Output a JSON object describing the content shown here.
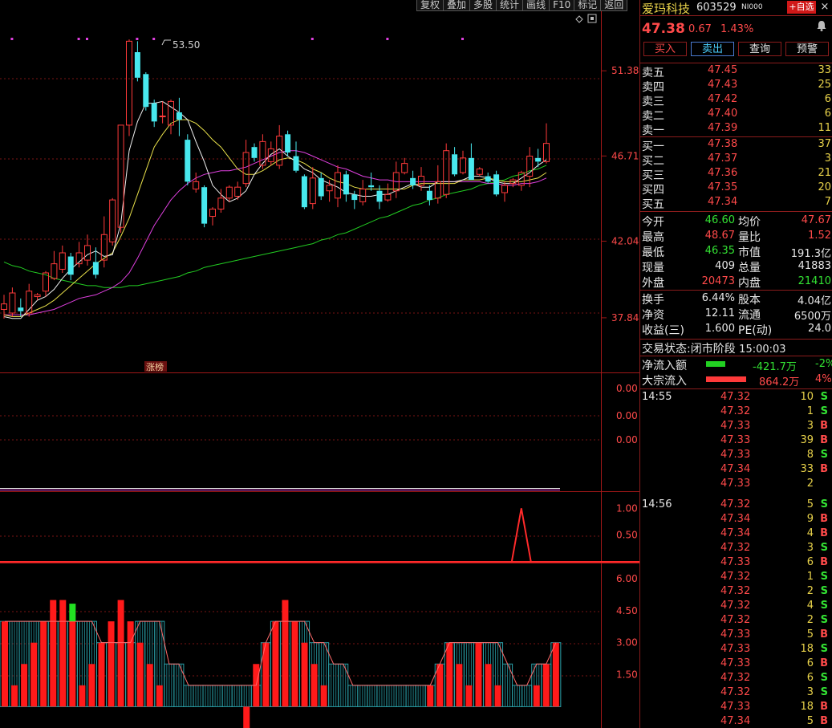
{
  "toolbar": [
    "复权",
    "叠加",
    "多股",
    "统计",
    "画线",
    "F10",
    "标记",
    "返回"
  ],
  "stock": {
    "name": "爱玛科技",
    "code": "603529",
    "tag": "NI000",
    "price": "47.38",
    "change": "0.67",
    "change_pct": "1.43%",
    "fav_label": "+自选",
    "close_label": "×"
  },
  "trade_buttons": [
    "买入",
    "卖出",
    "查询",
    "预警"
  ],
  "order_book": {
    "asks": [
      {
        "label": "卖五",
        "price": "47.45",
        "volume": "33"
      },
      {
        "label": "卖四",
        "price": "47.43",
        "volume": "25"
      },
      {
        "label": "卖三",
        "price": "47.42",
        "volume": "6"
      },
      {
        "label": "卖二",
        "price": "47.40",
        "volume": "6"
      },
      {
        "label": "卖一",
        "price": "47.39",
        "volume": "11"
      }
    ],
    "bids": [
      {
        "label": "买一",
        "price": "47.38",
        "volume": "37"
      },
      {
        "label": "买二",
        "price": "47.37",
        "volume": "3"
      },
      {
        "label": "买三",
        "price": "47.36",
        "volume": "21"
      },
      {
        "label": "买四",
        "price": "47.35",
        "volume": "20"
      },
      {
        "label": "买五",
        "price": "47.34",
        "volume": "7"
      }
    ]
  },
  "stats": {
    "open_label": "今开",
    "open": "46.60",
    "avg_label": "均价",
    "avg": "47.67",
    "high_label": "最高",
    "high": "48.67",
    "vol_ratio_label": "量比",
    "vol_ratio": "1.52",
    "low_label": "最低",
    "low": "46.35",
    "mktcap_label": "市值",
    "mktcap": "191.3亿",
    "cur_vol_label": "现量",
    "cur_vol": "409",
    "total_vol_label": "总量",
    "total_vol": "41883",
    "outer_label": "外盘",
    "outer": "20473",
    "inner_label": "内盘",
    "inner": "21410",
    "turnover_label": "换手",
    "turnover": "6.44%",
    "shares_label": "股本",
    "shares": "4.04亿",
    "nav_label": "净资",
    "nav": "12.11",
    "float_label": "流通",
    "float": "6500万",
    "eps_label": "收益(三)",
    "eps": "1.600",
    "pe_label": "PE(动)",
    "pe": "24.0"
  },
  "status": {
    "label": "交易状态:",
    "value": "闭市阶段",
    "time": "15:00:03"
  },
  "flows": {
    "net_label": "净流入额",
    "net_value": "-421.7万",
    "net_pct": "-2%",
    "block_label": "大宗流入",
    "block_value": "864.2万",
    "block_pct": "4%"
  },
  "ticks": [
    {
      "time": "14:55",
      "price": "47.32",
      "vol": "10",
      "side": "S"
    },
    {
      "time": "",
      "price": "47.32",
      "vol": "1",
      "side": "S"
    },
    {
      "time": "",
      "price": "47.33",
      "vol": "3",
      "side": "B"
    },
    {
      "time": "",
      "price": "47.33",
      "vol": "39",
      "side": "B"
    },
    {
      "time": "",
      "price": "47.33",
      "vol": "8",
      "side": "S"
    },
    {
      "time": "",
      "price": "47.34",
      "vol": "33",
      "side": "B"
    },
    {
      "time": "",
      "price": "47.33",
      "vol": "2",
      "side": ""
    },
    {
      "time": "14:56",
      "price": "47.32",
      "vol": "5",
      "side": "S"
    },
    {
      "time": "",
      "price": "47.34",
      "vol": "9",
      "side": "B"
    },
    {
      "time": "",
      "price": "47.34",
      "vol": "4",
      "side": "B"
    },
    {
      "time": "",
      "price": "47.32",
      "vol": "3",
      "side": "S"
    },
    {
      "time": "",
      "price": "47.33",
      "vol": "6",
      "side": "B"
    },
    {
      "time": "",
      "price": "47.32",
      "vol": "1",
      "side": "S"
    },
    {
      "time": "",
      "price": "47.32",
      "vol": "2",
      "side": "S"
    },
    {
      "time": "",
      "price": "47.32",
      "vol": "4",
      "side": "S"
    },
    {
      "time": "",
      "price": "47.32",
      "vol": "2",
      "side": "S"
    },
    {
      "time": "",
      "price": "47.33",
      "vol": "5",
      "side": "B"
    },
    {
      "time": "",
      "price": "47.33",
      "vol": "18",
      "side": "S"
    },
    {
      "time": "",
      "price": "47.33",
      "vol": "6",
      "side": "B"
    },
    {
      "time": "",
      "price": "47.32",
      "vol": "6",
      "side": "S"
    },
    {
      "time": "",
      "price": "47.32",
      "vol": "3",
      "side": "S"
    },
    {
      "time": "",
      "price": "47.33",
      "vol": "18",
      "side": "B"
    },
    {
      "time": "",
      "price": "47.34",
      "vol": "5",
      "side": "B"
    }
  ],
  "chart_data": {
    "type": "candlestick",
    "price_axis": {
      "ticks": [
        "51.38",
        "46.71",
        "42.04",
        "37.84"
      ],
      "ylim": [
        35.9,
        54.6
      ]
    },
    "high_label": "53.50",
    "limit_up_label": "涨榜",
    "colors": {
      "up": "#ff3a3a",
      "down": "#48e8ee",
      "ma1": "#f0f0f0",
      "ma2": "#e8e04a",
      "ma3": "#e040e0",
      "ma4": "#22cc22"
    },
    "candles": [
      [
        38.3,
        38.6,
        37.8,
        39.1
      ],
      [
        38.1,
        39.2,
        37.9,
        39.5
      ],
      [
        38.4,
        38.2,
        37.9,
        38.9
      ],
      [
        38.1,
        39.3,
        37.9,
        39.7
      ],
      [
        39.0,
        39.1,
        38.8,
        39.2
      ],
      [
        39.3,
        40.3,
        39.0,
        40.4
      ],
      [
        40.0,
        40.8,
        39.9,
        41.5
      ],
      [
        40.5,
        41.4,
        40.3,
        41.8
      ],
      [
        41.2,
        40.2,
        39.9,
        41.4
      ],
      [
        40.8,
        41.4,
        40.6,
        42.0
      ],
      [
        41.0,
        41.8,
        40.7,
        42.4
      ],
      [
        40.9,
        40.2,
        40.0,
        41.7
      ],
      [
        41.0,
        42.4,
        40.6,
        43.4
      ],
      [
        42.0,
        44.3,
        41.8,
        44.4
      ],
      [
        42.8,
        48.4,
        42.5,
        48.4
      ],
      [
        48.4,
        53.0,
        47.8,
        53.1
      ],
      [
        52.4,
        51.0,
        50.8,
        53.0
      ],
      [
        51.2,
        49.4,
        49.2,
        51.3
      ],
      [
        49.6,
        48.6,
        48.3,
        49.8
      ],
      [
        48.9,
        48.9,
        48.5,
        49.7
      ],
      [
        48.4,
        49.7,
        47.9,
        49.8
      ],
      [
        49.1,
        48.7,
        47.8,
        49.9
      ],
      [
        47.6,
        45.3,
        45.1,
        47.9
      ],
      [
        44.9,
        45.3,
        44.7,
        45.8
      ],
      [
        45.0,
        43.0,
        42.8,
        45.1
      ],
      [
        43.4,
        43.8,
        42.9,
        43.9
      ],
      [
        43.8,
        44.4,
        43.6,
        44.9
      ],
      [
        44.4,
        45.0,
        44.2,
        45.1
      ],
      [
        44.5,
        45.0,
        44.3,
        45.3
      ],
      [
        45.2,
        46.9,
        45.0,
        47.6
      ],
      [
        47.2,
        46.6,
        46.4,
        47.4
      ],
      [
        46.2,
        47.5,
        46.0,
        47.9
      ],
      [
        46.4,
        47.1,
        46.2,
        47.5
      ],
      [
        46.2,
        47.8,
        46.0,
        48.4
      ],
      [
        47.9,
        46.9,
        46.7,
        48.1
      ],
      [
        46.7,
        45.9,
        45.8,
        47.5
      ],
      [
        45.6,
        43.9,
        43.8,
        45.7
      ],
      [
        44.1,
        45.5,
        43.8,
        46.1
      ],
      [
        45.5,
        44.5,
        44.3,
        45.8
      ],
      [
        44.8,
        45.1,
        44.2,
        45.4
      ],
      [
        44.4,
        45.8,
        43.9,
        46.2
      ],
      [
        45.7,
        44.6,
        44.2,
        45.9
      ],
      [
        44.6,
        44.3,
        43.8,
        44.8
      ],
      [
        44.2,
        44.9,
        44.0,
        45.4
      ],
      [
        45.1,
        45.0,
        44.8,
        45.8
      ],
      [
        44.8,
        44.2,
        43.8,
        45.1
      ],
      [
        44.3,
        44.6,
        44.2,
        45.2
      ],
      [
        44.8,
        45.8,
        44.4,
        46.4
      ],
      [
        45.8,
        46.3,
        45.7,
        46.6
      ],
      [
        45.5,
        45.1,
        44.9,
        45.9
      ],
      [
        45.1,
        45.6,
        44.8,
        46.1
      ],
      [
        44.8,
        44.3,
        44.0,
        45.1
      ],
      [
        44.4,
        45.3,
        44.1,
        46.2
      ],
      [
        44.6,
        47.0,
        44.4,
        47.4
      ],
      [
        46.8,
        45.7,
        45.6,
        47.2
      ],
      [
        45.8,
        46.6,
        45.7,
        47.0
      ],
      [
        46.6,
        45.4,
        45.4,
        47.4
      ],
      [
        45.7,
        46.0,
        45.6,
        46.1
      ],
      [
        45.6,
        45.3,
        45.2,
        45.8
      ],
      [
        45.7,
        44.6,
        44.5,
        45.9
      ],
      [
        44.7,
        45.1,
        44.2,
        45.3
      ],
      [
        45.2,
        45.4,
        45.0,
        45.5
      ],
      [
        45.1,
        45.8,
        44.8,
        45.9
      ],
      [
        45.6,
        46.7,
        45.0,
        47.2
      ],
      [
        46.6,
        46.4,
        46.1,
        47.1
      ],
      [
        46.4,
        47.4,
        46.3,
        48.5
      ]
    ],
    "ma1": [
      37.9,
      37.8,
      37.8,
      38.3,
      38.8,
      39.0,
      39.4,
      40.0,
      40.5,
      40.9,
      41.3,
      41.5,
      41.2,
      41.3,
      43.0,
      47.0,
      48.6,
      49.6,
      49.6,
      49.7,
      49.4,
      49.1,
      48.7,
      47.5,
      46.4,
      45.1,
      44.6,
      44.2,
      44.4,
      44.8,
      45.7,
      46.3,
      46.8,
      47.1,
      46.7,
      46.4,
      46.0,
      45.8,
      45.4,
      45.2,
      45.0,
      44.7,
      44.6,
      44.5,
      44.5,
      44.6,
      44.6,
      44.8,
      45.0,
      45.2,
      45.0,
      45.0,
      45.3,
      45.3,
      45.3,
      45.4,
      45.6,
      45.6,
      45.5,
      45.3,
      45.2,
      45.2,
      45.5,
      45.8,
      46.2,
      46.5
    ],
    "ma2": [
      38.0,
      37.9,
      37.9,
      38.1,
      38.3,
      38.5,
      38.8,
      39.2,
      39.6,
      40.0,
      40.4,
      40.8,
      41.1,
      41.4,
      42.3,
      43.3,
      44.6,
      45.9,
      47.2,
      47.9,
      48.5,
      48.7,
      48.7,
      48.5,
      48.1,
      47.6,
      47.2,
      46.6,
      46.0,
      45.7,
      45.7,
      45.9,
      46.2,
      46.5,
      46.6,
      46.5,
      46.3,
      46.0,
      45.8,
      45.5,
      45.3,
      45.2,
      45.0,
      44.9,
      44.9,
      44.9,
      44.9,
      44.9,
      44.9,
      45.1,
      45.2,
      45.2,
      45.2,
      45.2,
      45.2,
      45.4,
      45.4,
      45.4,
      45.5,
      45.4,
      45.3,
      45.3,
      45.3,
      45.4,
      45.5,
      45.8
    ],
    "ma3": [
      38.0,
      38.0,
      38.0,
      38.0,
      38.1,
      38.2,
      38.3,
      38.5,
      38.7,
      38.9,
      39.0,
      39.1,
      39.3,
      39.5,
      39.8,
      40.3,
      41.1,
      42.0,
      42.9,
      43.6,
      44.3,
      44.8,
      45.2,
      45.5,
      45.7,
      45.8,
      45.9,
      45.9,
      46.0,
      46.1,
      46.3,
      46.5,
      46.7,
      46.9,
      47.0,
      47.0,
      46.9,
      46.7,
      46.5,
      46.3,
      46.1,
      46.0,
      45.8,
      45.6,
      45.5,
      45.4,
      45.4,
      45.3,
      45.3,
      45.3,
      45.3,
      45.3,
      45.3,
      45.3,
      45.3,
      45.3,
      45.3,
      45.3,
      45.2,
      45.2,
      45.1,
      45.1,
      45.2,
      45.2,
      45.3,
      45.5
    ],
    "ma4": [
      40.9,
      40.7,
      40.6,
      40.4,
      40.3,
      40.2,
      40.0,
      39.9,
      39.8,
      39.7,
      39.6,
      39.6,
      39.5,
      39.5,
      39.5,
      39.6,
      39.6,
      39.7,
      39.8,
      39.9,
      40.0,
      40.1,
      40.3,
      40.4,
      40.6,
      40.7,
      40.8,
      40.9,
      41.0,
      41.1,
      41.2,
      41.3,
      41.4,
      41.5,
      41.6,
      41.7,
      41.8,
      41.9,
      42.1,
      42.2,
      42.4,
      42.5,
      42.7,
      42.9,
      43.1,
      43.3,
      43.4,
      43.6,
      43.8,
      44.0,
      44.1,
      44.3,
      44.4,
      44.6,
      44.7,
      44.8,
      44.9,
      45.1,
      45.2,
      45.3,
      45.4,
      45.6,
      45.7,
      45.9,
      46.0,
      46.2
    ],
    "panel2": {
      "ticks": [
        "0.00",
        "0.00",
        "0.00"
      ]
    },
    "panel3": {
      "ticks": [
        "1.00",
        "0.50"
      ],
      "ylim": [
        0,
        1.2
      ],
      "spike_index": 62,
      "spike_value": 1.0
    },
    "panel4": {
      "ticks": [
        "6.00",
        "4.50",
        "3.00",
        "1.50"
      ],
      "ylim": [
        -1,
        6.6
      ],
      "red_bars": [
        4,
        1,
        2,
        3,
        4,
        5,
        5,
        4,
        1,
        2,
        3,
        4,
        5,
        4,
        3,
        2,
        1,
        0,
        0,
        0,
        0,
        0,
        0,
        0,
        0,
        -1,
        2,
        3,
        4,
        5,
        4,
        3,
        2,
        1,
        0,
        0,
        0,
        0,
        0,
        0,
        0,
        0,
        0,
        0,
        1,
        2,
        3,
        2,
        1,
        3,
        2,
        1,
        0,
        0,
        0,
        1,
        2,
        3
      ],
      "cyan_bars": [
        4,
        4,
        4,
        4,
        4,
        4,
        4,
        4,
        4,
        4,
        3,
        3,
        3,
        3,
        4,
        4,
        4,
        2,
        2,
        1,
        1,
        1,
        1,
        1,
        1,
        1,
        1,
        3,
        4,
        4,
        4,
        4,
        3,
        3,
        2,
        2,
        1,
        1,
        1,
        1,
        1,
        1,
        1,
        1,
        1,
        2,
        3,
        3,
        3,
        3,
        3,
        3,
        2,
        1,
        1,
        2,
        2,
        3
      ],
      "highlight_index": 7
    }
  }
}
